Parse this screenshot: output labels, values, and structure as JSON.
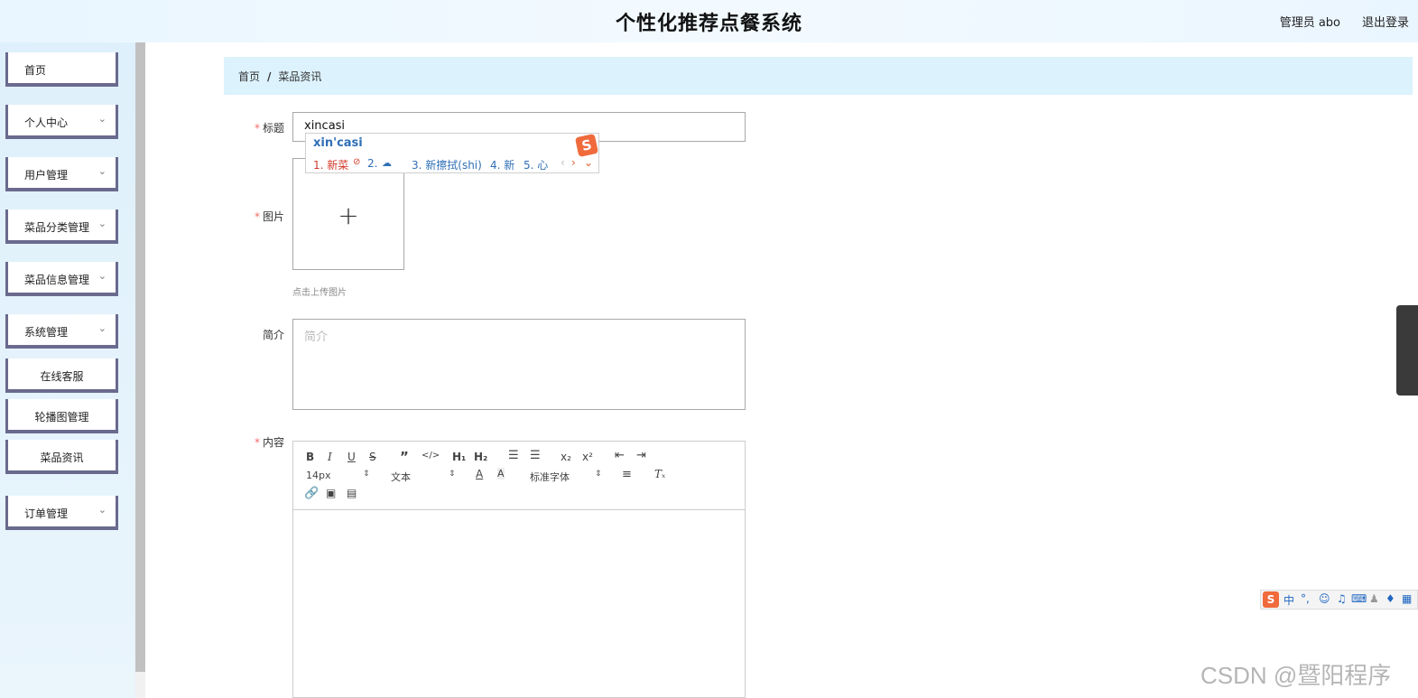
{
  "header": {
    "title": "个性化推荐点餐系统",
    "admin_label": "管理员 abo",
    "logout": "退出登录"
  },
  "sidebar": {
    "items": [
      {
        "label": "首页",
        "has_children": false
      },
      {
        "label": "个人中心",
        "has_children": true
      },
      {
        "label": "用户管理",
        "has_children": true
      },
      {
        "label": "菜品分类管理",
        "has_children": true
      },
      {
        "label": "菜品信息管理",
        "has_children": true
      },
      {
        "label": "系统管理",
        "has_children": true
      },
      {
        "label": "在线客服",
        "has_children": false
      },
      {
        "label": "轮播图管理",
        "has_children": false
      },
      {
        "label": "菜品资讯",
        "has_children": false
      },
      {
        "label": "订单管理",
        "has_children": true
      }
    ]
  },
  "breadcrumb": {
    "home": "首页",
    "separator": "/",
    "current": "菜品资讯"
  },
  "form": {
    "title_label": "标题",
    "title_value": "xincasi",
    "image_label": "图片",
    "upload_tip": "点击上传图片",
    "intro_label": "简介",
    "intro_placeholder": "简介",
    "content_label": "内容"
  },
  "editor": {
    "size_select": "14px",
    "header_select": "文本",
    "font_select": "标准字体",
    "superscript_label": "x²",
    "subscript_label": "x₂",
    "h1_label": "H₁",
    "h2_label": "H₂"
  },
  "ime": {
    "pinyin": "xin'casi",
    "candidates": [
      "1. 新菜",
      "2.",
      "3. 新擦拭(shi)",
      "4. 新",
      "5. 心"
    ]
  },
  "ime_status": {
    "lang": "中"
  },
  "watermark": "CSDN @暨阳程序",
  "colors": {
    "required_star": "#f56c6c",
    "breadcrumb_bg": "#dcf2fc",
    "menu_border": "#6a6a8e"
  }
}
